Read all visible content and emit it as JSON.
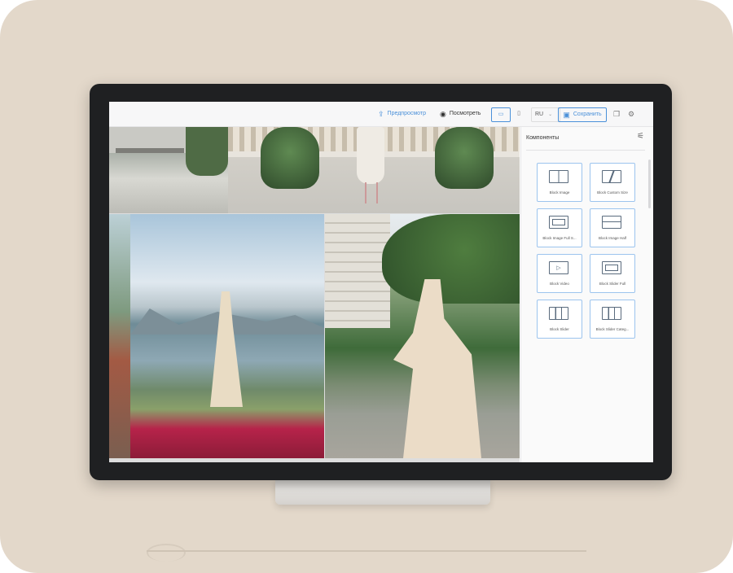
{
  "toolbar": {
    "preview_label": "Предпросмотр",
    "view_label": "Посмотреть",
    "language": "RU",
    "save_label": "Сохранить",
    "icons": {
      "preview": "share-icon",
      "view": "eye-icon",
      "desktop": "monitor-icon",
      "mobile": "phone-icon",
      "save": "floppy-icon",
      "copy": "copy-icon",
      "settings": "gear-icon"
    },
    "accent_color": "#4a90d9"
  },
  "sidebar": {
    "title": "Компоненты",
    "components": [
      {
        "label": "Block Image",
        "icon": "block-image-icon"
      },
      {
        "label": "Block Custom Size",
        "icon": "block-custom-size-icon"
      },
      {
        "label": "Block Image Full S...",
        "icon": "block-image-full-icon"
      },
      {
        "label": "Block Image Half",
        "icon": "block-image-half-icon"
      },
      {
        "label": "Block Video",
        "icon": "block-video-icon"
      },
      {
        "label": "Block Slider Full",
        "icon": "block-slider-full-icon"
      },
      {
        "label": "Block Slider",
        "icon": "block-slider-icon"
      },
      {
        "label": "Block Slider Categ...",
        "icon": "block-slider-category-icon"
      }
    ]
  }
}
